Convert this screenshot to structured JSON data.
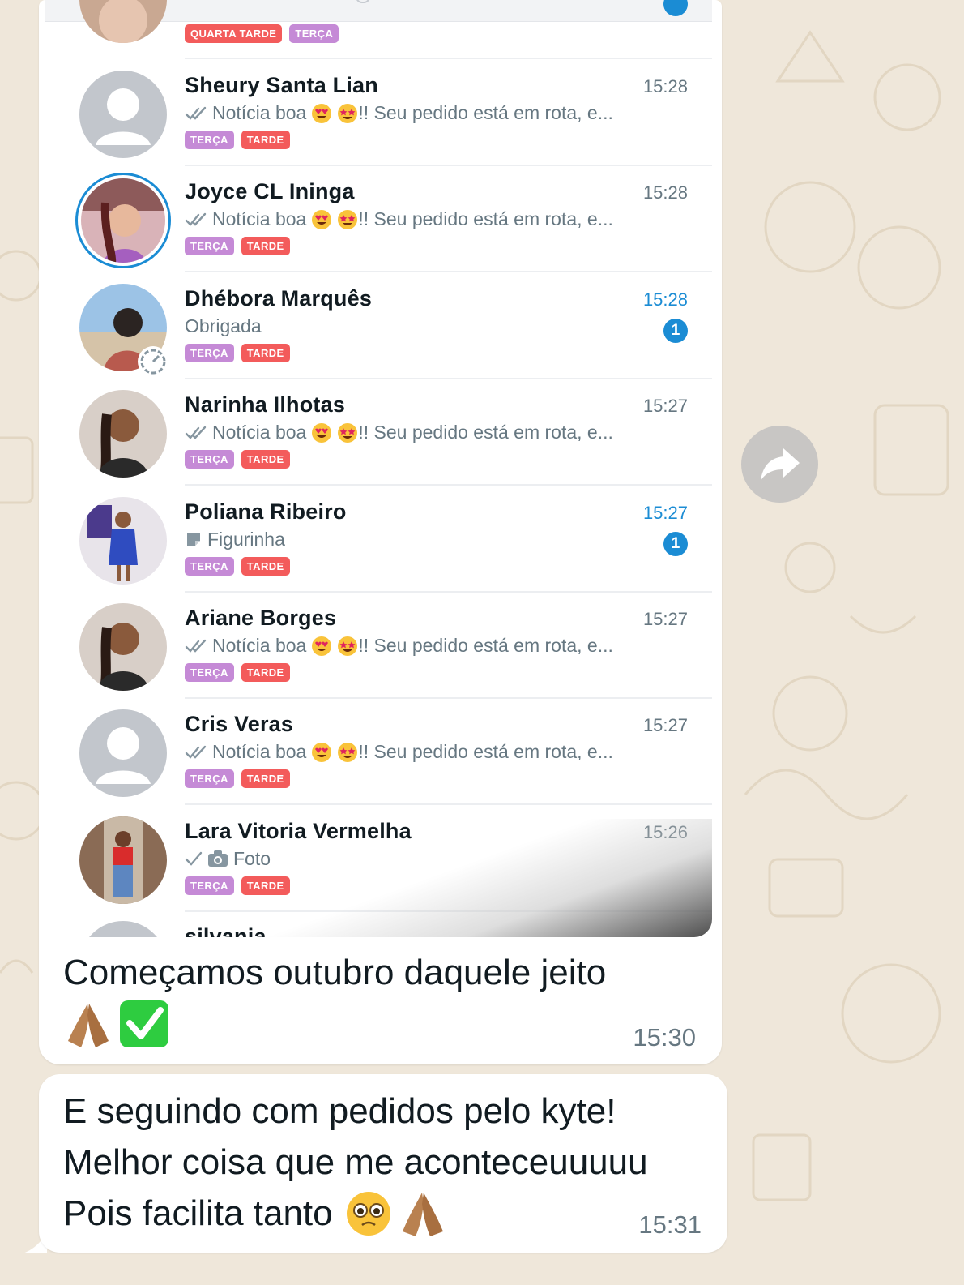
{
  "chat_list": {
    "partial_top_tags": [
      "QUARTA TARDE",
      "TERÇA"
    ],
    "rows": [
      {
        "name": "Sheury Santa Lian",
        "time": "15:28",
        "preview_prefix": "Notícia boa",
        "preview_suffix": "!! Seu pedido está em rota, e...",
        "status": "read",
        "tags": [
          "TERÇA",
          "TARDE"
        ],
        "avatar": "default-avatar",
        "unread": null
      },
      {
        "name": "Joyce CL Ininga",
        "time": "15:28",
        "preview_prefix": "Notícia boa",
        "preview_suffix": "!! Seu pedido está em rota, e...",
        "status": "read",
        "tags": [
          "TERÇA",
          "TARDE"
        ],
        "avatar": "photo-avatar-story-ring",
        "unread": null
      },
      {
        "name": "Dhébora Marquês",
        "time": "15:28",
        "preview_prefix": "Obrigada",
        "preview_suffix": "",
        "status": "none",
        "tags": [
          "TERÇA",
          "TARDE"
        ],
        "avatar": "photo-avatar-beach",
        "unread": "1"
      },
      {
        "name": "Narinha Ilhotas",
        "time": "15:27",
        "preview_prefix": "Notícia boa",
        "preview_suffix": "!! Seu pedido está em rota, e...",
        "status": "read",
        "tags": [
          "TERÇA",
          "TARDE"
        ],
        "avatar": "photo-avatar",
        "unread": null
      },
      {
        "name": "Poliana Ribeiro",
        "time": "15:27",
        "preview_prefix": "Figurinha",
        "preview_suffix": "",
        "status": "sticker",
        "tags": [
          "TERÇA",
          "TARDE"
        ],
        "avatar": "photo-avatar-blue-dress",
        "unread": "1"
      },
      {
        "name": "Ariane Borges",
        "time": "15:27",
        "preview_prefix": "Notícia boa",
        "preview_suffix": "!! Seu pedido está em rota, e...",
        "status": "read",
        "tags": [
          "TERÇA",
          "TARDE"
        ],
        "avatar": "photo-avatar",
        "unread": null
      },
      {
        "name": "Cris Veras",
        "time": "15:27",
        "preview_prefix": "Notícia boa",
        "preview_suffix": "!! Seu pedido está em rota, e...",
        "status": "read",
        "tags": [
          "TERÇA",
          "TARDE"
        ],
        "avatar": "default-avatar",
        "unread": null
      },
      {
        "name": "Lara Vitoria Vermelha",
        "time": "15:26",
        "preview_prefix": "Foto",
        "preview_suffix": "",
        "status": "sent-photo",
        "tags": [
          "TERÇA",
          "TARDE"
        ],
        "avatar": "photo-avatar-red-top",
        "unread": null
      }
    ],
    "cutoff_name": "silvania"
  },
  "messages": [
    {
      "lines": [
        "Começamos outubro daquele jeito"
      ],
      "emoji_line": "🙏🏽✅",
      "time": "15:30"
    },
    {
      "lines": [
        "E seguindo com pedidos pelo kyte!",
        "Melhor coisa que me aconteceuuuuu",
        "Pois facilita tanto"
      ],
      "emoji_line": "🥹🙏🏽",
      "time": "15:31"
    }
  ],
  "colors": {
    "wallpaper": "#efe7da",
    "bubble": "#ffffff",
    "tag_terca": "#c58ad6",
    "tag_tarde": "#f35b5b",
    "unread": "#1b8cd4"
  }
}
